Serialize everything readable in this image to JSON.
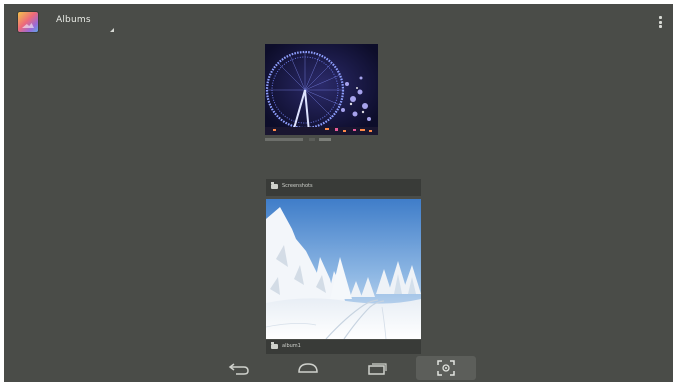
{
  "action_bar": {
    "app_icon": "gallery-app-icon",
    "title": "Albums",
    "spinner_icon": "spinner-dropdown-icon",
    "menu_icon": "overflow-menu-icon"
  },
  "albums": [
    {
      "name": "Screenshots",
      "thumbnail": "ferris-wheel-night-photo",
      "count": ""
    },
    {
      "name": "album1",
      "thumbnail": "snowy-forest-photo",
      "count": ""
    }
  ],
  "nav_bar": {
    "back_icon": "back-icon",
    "home_icon": "home-icon",
    "recents_icon": "recent-apps-icon",
    "screenshot_icon": "screenshot-capture-icon"
  },
  "colors": {
    "background": "#4a4c48",
    "card_header": "#393b38",
    "text": "#e9ebe6"
  }
}
